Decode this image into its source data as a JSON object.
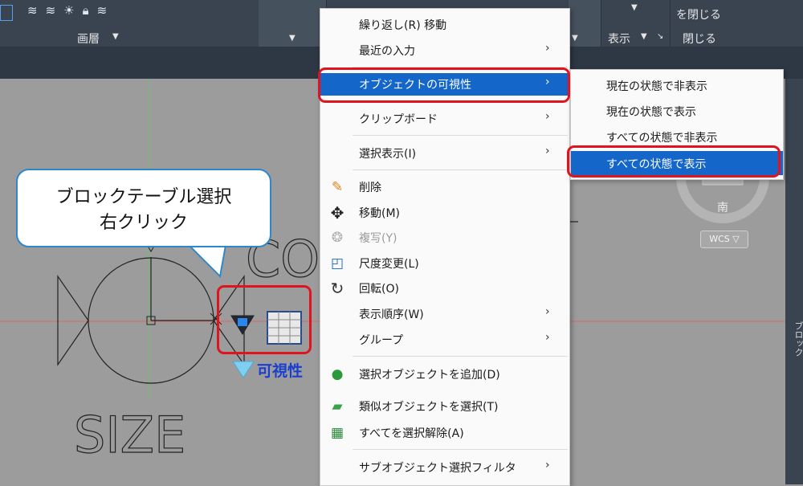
{
  "ribbon": {
    "layer_panel_label": "画層",
    "view_label": "表示",
    "close_top_label": "を閉じる",
    "close_label": "閉じる"
  },
  "canvas": {
    "size_text": "SIZE",
    "partial_text": "CO",
    "visibility_label": "可視性",
    "compass_south": "南",
    "wcs_label": "WCS ▽",
    "right_palette_label": "ブロック"
  },
  "callout": {
    "line1": "ブロックテーブル選択",
    "line2": "右クリック"
  },
  "context_menu": {
    "items": [
      {
        "label": "繰り返し(R) 移動",
        "icon": "",
        "submenu": false,
        "disabled": false
      },
      {
        "label": "最近の入力",
        "icon": "",
        "submenu": true,
        "disabled": false
      },
      {
        "label": "オブジェクトの可視性",
        "icon": "",
        "submenu": true,
        "disabled": false,
        "highlighted": true
      },
      {
        "label": "クリップボード",
        "icon": "",
        "submenu": true,
        "disabled": false
      },
      {
        "label": "選択表示(I)",
        "icon": "",
        "submenu": true,
        "disabled": false
      },
      {
        "label": "削除",
        "icon": "eraser-icon",
        "submenu": false,
        "disabled": false
      },
      {
        "label": "移動(M)",
        "icon": "move-icon",
        "submenu": false,
        "disabled": false
      },
      {
        "label": "複写(Y)",
        "icon": "copy-icon",
        "submenu": false,
        "disabled": true
      },
      {
        "label": "尺度変更(L)",
        "icon": "scale-icon",
        "submenu": false,
        "disabled": false
      },
      {
        "label": "回転(O)",
        "icon": "rotate-icon",
        "submenu": false,
        "disabled": false
      },
      {
        "label": "表示順序(W)",
        "icon": "",
        "submenu": true,
        "disabled": false
      },
      {
        "label": "グループ",
        "icon": "",
        "submenu": true,
        "disabled": false
      },
      {
        "label": "選択オブジェクトを追加(D)",
        "icon": "add-selected-icon",
        "submenu": false,
        "disabled": false
      },
      {
        "label": "類似オブジェクトを選択(T)",
        "icon": "select-similar-icon",
        "submenu": false,
        "disabled": false
      },
      {
        "label": "すべてを選択解除(A)",
        "icon": "deselect-all-icon",
        "submenu": false,
        "disabled": false
      },
      {
        "label": "サブオブジェクト選択フィルタ",
        "icon": "",
        "submenu": true,
        "disabled": false
      }
    ]
  },
  "visibility_submenu": {
    "items": [
      {
        "label": "現在の状態で非表示",
        "highlighted": false
      },
      {
        "label": "現在の状態で表示",
        "highlighted": false
      },
      {
        "label": "すべての状態で非表示",
        "highlighted": false
      },
      {
        "label": "すべての状態で表示",
        "highlighted": true
      }
    ]
  },
  "colors": {
    "highlight": "#1566c9",
    "annotation_red": "#e0141e",
    "callout_border": "#2f86c8",
    "visibility_text": "#1a3fd0"
  }
}
